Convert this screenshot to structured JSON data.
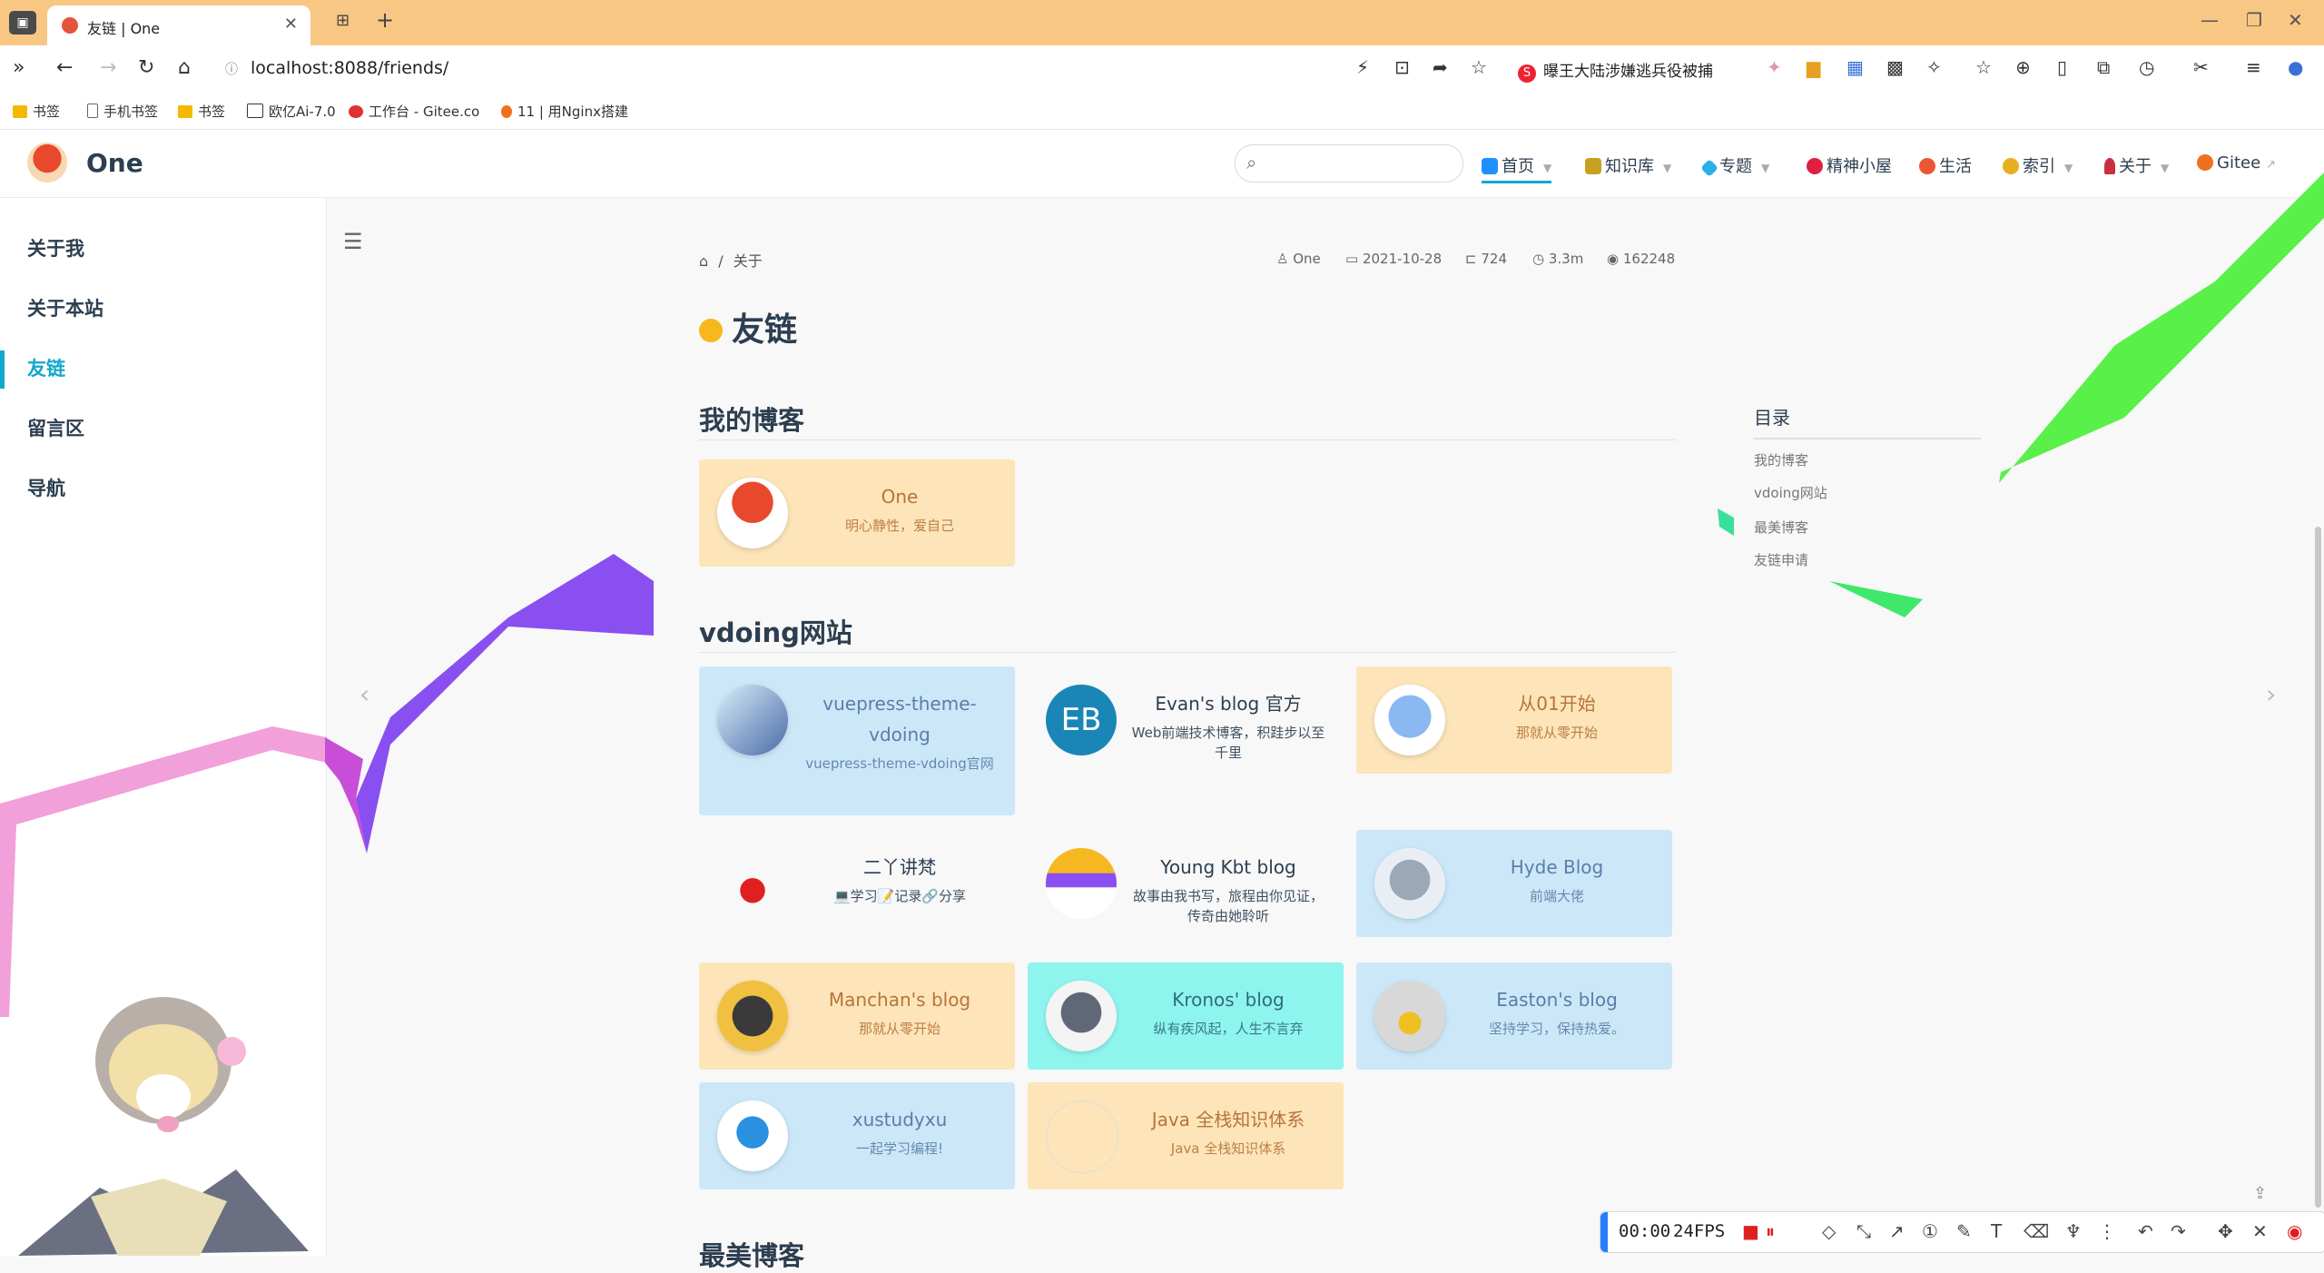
{
  "browser": {
    "tab_title": "友链 | One",
    "url": "localhost:8088/friends/",
    "news_text": "曝王大陆涉嫌逃兵役被捕",
    "bookmarks": [
      "书签",
      "手机书签",
      "书签",
      "欧亿Ai-7.0",
      "工作台 - Gitee.co",
      "11 | 用Nginx搭建"
    ]
  },
  "site": {
    "name": "One",
    "nav": [
      {
        "label": "首页",
        "caret": true
      },
      {
        "label": "知识库",
        "caret": true
      },
      {
        "label": "专题",
        "caret": true
      },
      {
        "label": "精神小屋",
        "caret": false
      },
      {
        "label": "生活",
        "caret": false
      },
      {
        "label": "索引",
        "caret": true
      },
      {
        "label": "关于",
        "caret": true
      },
      {
        "label": "Gitee",
        "caret": false
      }
    ]
  },
  "sidebar": {
    "items": [
      "关于我",
      "关于本站",
      "友链",
      "留言区",
      "导航"
    ]
  },
  "page": {
    "breadcrumb": "关于",
    "meta": {
      "author": "One",
      "date": "2021-10-28",
      "words": "724",
      "reading": "3.3m",
      "views": "162248"
    },
    "title": "友链"
  },
  "sections": {
    "my_blog": {
      "heading": "我的博客",
      "cards": [
        {
          "name": "One",
          "desc": "明心静性，爱自己"
        }
      ]
    },
    "vdoing": {
      "heading": "vdoing网站",
      "cards": [
        {
          "name": "vuepress-theme-vdoing",
          "desc": "vuepress-theme-vdoing官网"
        },
        {
          "name": "Evan's blog 官方",
          "desc": "Web前端技术博客，积跬步以至千里"
        },
        {
          "name": "从01开始",
          "desc": "那就从零开始"
        },
        {
          "name": "二丫讲梵",
          "desc": "💻学习📝记录🔗分享"
        },
        {
          "name": "Young Kbt blog",
          "desc": "故事由我书写，旅程由你见证，传奇由她聆听"
        },
        {
          "name": "Hyde Blog",
          "desc": "前端大佬"
        },
        {
          "name": "Manchan's blog",
          "desc": "那就从零开始"
        },
        {
          "name": "Kronos' blog",
          "desc": "纵有疾风起，人生不言弃"
        },
        {
          "name": "Easton's blog",
          "desc": "坚持学习，保持热爱。"
        },
        {
          "name": "xustudyxu",
          "desc": "一起学习编程!"
        },
        {
          "name": "Java 全栈知识体系",
          "desc": "Java 全栈知识体系"
        }
      ]
    },
    "next_heading": "最美博客"
  },
  "toc": {
    "title": "目录",
    "items": [
      "我的博客",
      "vdoing网站",
      "最美博客",
      "友链申请"
    ]
  },
  "recorder": {
    "time": "00:00",
    "fps": "24FPS"
  },
  "colors": {
    "accent": "#11a8cd",
    "card_orange": "#fde5b9",
    "card_blue": "#cce8f8",
    "card_cyan": "#8ef5ee"
  }
}
